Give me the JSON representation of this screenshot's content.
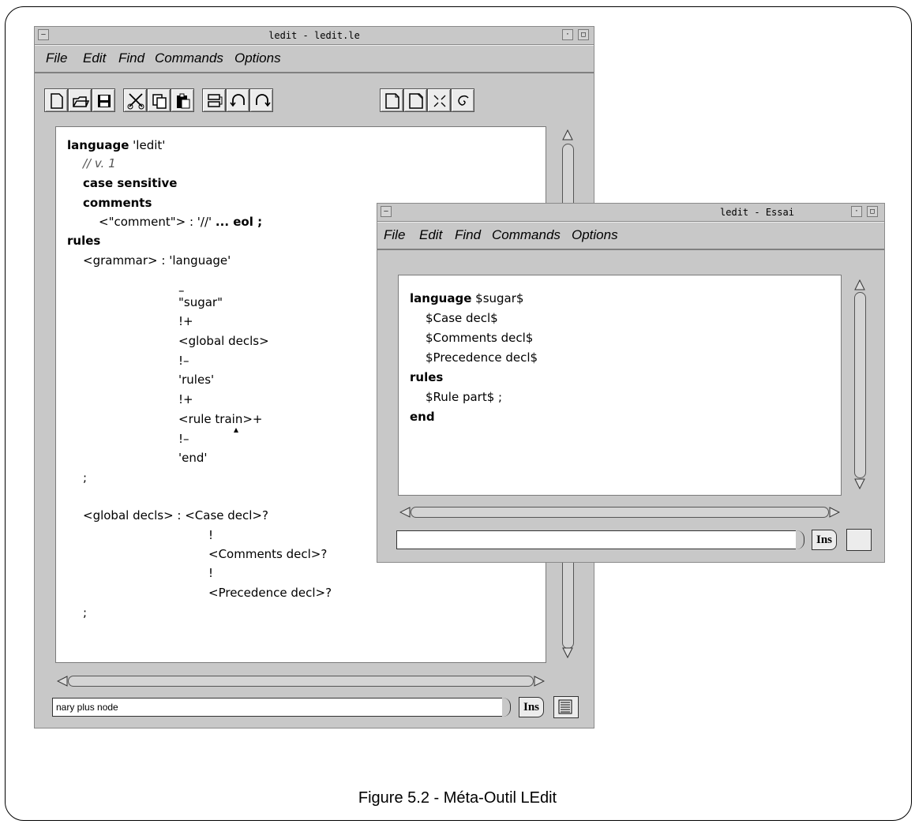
{
  "caption": "Figure 5.2 - Méta-Outil LEdit",
  "window1": {
    "title": "ledit - ledit.le",
    "menu": {
      "file": "File",
      "edit": "Edit",
      "find": "Find",
      "commands": "Commands",
      "options": "Options"
    },
    "toolbar_icons": [
      "new-file-icon",
      "open-file-icon",
      "save-icon",
      "cut-icon",
      "copy-icon",
      "paste-icon",
      "format-icon",
      "undo-icon",
      "redo-icon",
      "page-icon",
      "page-corner-icon",
      "collapse-icon",
      "spiral-icon"
    ],
    "code": {
      "l1_kw": "language",
      "l1_rest": " 'ledit'",
      "l2": "// v. 1",
      "l3": "case sensitive",
      "l4": "comments",
      "l5_a": "<\"comment\"> : '//' ",
      "l5_b": "... eol ;",
      "l6": "rules",
      "l7": "<grammar> : 'language'",
      "l8": "–",
      "l9": "\"sugar\"",
      "l10": "!+",
      "l11": "<global decls>",
      "l12": "!–",
      "l13": "'rules'",
      "l14": "!+",
      "l15": "<rule train>+",
      "l16": "!–",
      "l17": "'end'",
      "l18": ";",
      "l19": "<global decls> : <Case decl>?",
      "l20": "!",
      "l21": "<Comments decl>?",
      "l22": "!",
      "l23": "<Precedence decl>?",
      "l24": ";"
    },
    "status_text": "nary plus node",
    "ins_label": "Ins"
  },
  "window2": {
    "title": "ledit - Essai",
    "menu": {
      "file": "File",
      "edit": "Edit",
      "find": "Find",
      "commands": "Commands",
      "options": "Options"
    },
    "code": {
      "l1_kw": "language",
      "l1_rest": " $sugar$",
      "l2": "$Case decl$",
      "l3": "$Comments decl$",
      "l4": "$Precedence decl$",
      "l5": "rules",
      "l6": "$Rule part$ ;",
      "l7": "end"
    },
    "status_text": "",
    "ins_label": "Ins"
  }
}
